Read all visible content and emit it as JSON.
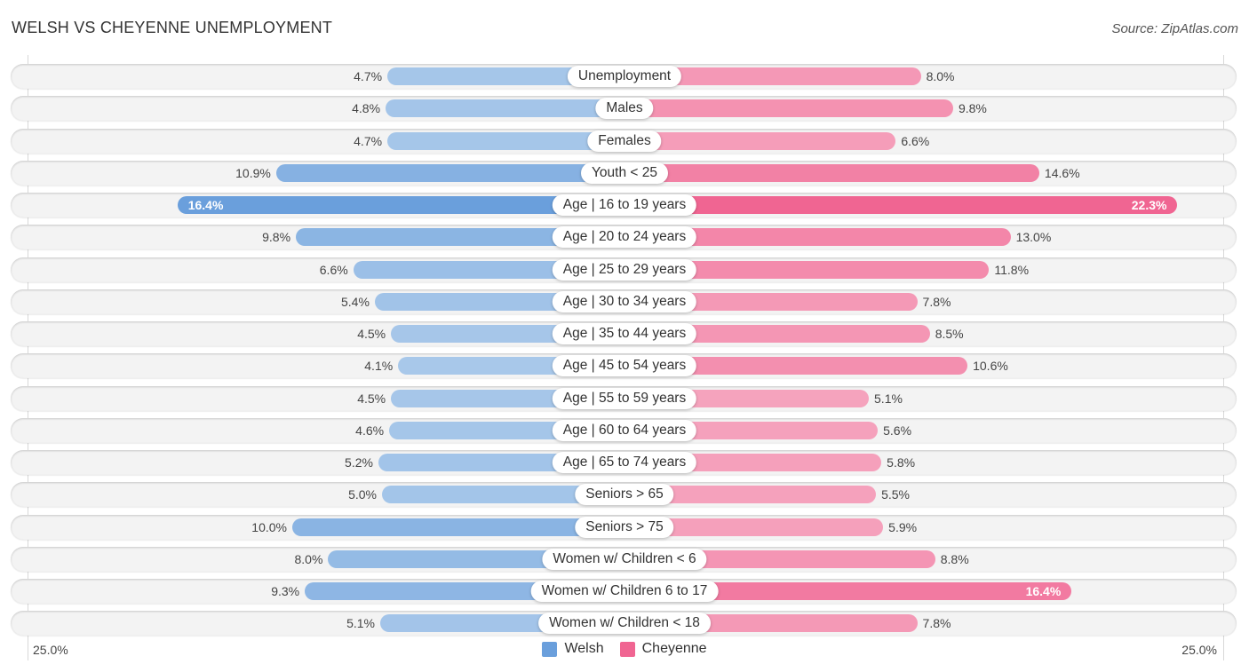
{
  "header": {
    "title": "WELSH VS CHEYENNE UNEMPLOYMENT",
    "source": "Source: ZipAtlas.com"
  },
  "legend": {
    "items": [
      {
        "label": "Welsh",
        "color": "#6a9fdc"
      },
      {
        "label": "Cheyenne",
        "color": "#f06592"
      }
    ]
  },
  "axis": {
    "left_label": "25.0%",
    "right_label": "25.0%"
  },
  "colors": {
    "welsh_light": "#a8c8ea",
    "welsh_dark": "#6a9fdc",
    "cheyenne_light": "#f5a3bd",
    "cheyenne_dark": "#f06592"
  },
  "chart_data": {
    "type": "bar",
    "orientation": "horizontal-diverging",
    "title": "WELSH VS CHEYENNE UNEMPLOYMENT",
    "xlabel": "",
    "ylabel": "",
    "xlim": [
      0,
      25.0
    ],
    "unit": "%",
    "legend_position": "bottom-center",
    "categories": [
      "Unemployment",
      "Males",
      "Females",
      "Youth < 25",
      "Age | 16 to 19 years",
      "Age | 20 to 24 years",
      "Age | 25 to 29 years",
      "Age | 30 to 34 years",
      "Age | 35 to 44 years",
      "Age | 45 to 54 years",
      "Age | 55 to 59 years",
      "Age | 60 to 64 years",
      "Age | 65 to 74 years",
      "Seniors > 65",
      "Seniors > 75",
      "Women w/ Children < 6",
      "Women w/ Children 6 to 17",
      "Women w/ Children < 18"
    ],
    "series": [
      {
        "name": "Welsh",
        "side": "left",
        "values": [
          4.7,
          4.8,
          4.7,
          10.9,
          16.4,
          9.8,
          6.6,
          5.4,
          4.5,
          4.1,
          4.5,
          4.6,
          5.2,
          5.0,
          10.0,
          8.0,
          9.3,
          5.1
        ],
        "labels": [
          "4.7%",
          "4.8%",
          "4.7%",
          "10.9%",
          "16.4%",
          "9.8%",
          "6.6%",
          "5.4%",
          "4.5%",
          "4.1%",
          "4.5%",
          "4.6%",
          "5.2%",
          "5.0%",
          "10.0%",
          "8.0%",
          "9.3%",
          "5.1%"
        ]
      },
      {
        "name": "Cheyenne",
        "side": "right",
        "values": [
          8.0,
          9.8,
          6.6,
          14.6,
          22.3,
          13.0,
          11.8,
          7.8,
          8.5,
          10.6,
          5.1,
          5.6,
          5.8,
          5.5,
          5.9,
          8.8,
          16.4,
          7.8
        ],
        "labels": [
          "8.0%",
          "9.8%",
          "6.6%",
          "14.6%",
          "22.3%",
          "13.0%",
          "11.8%",
          "7.8%",
          "8.5%",
          "10.6%",
          "5.1%",
          "5.6%",
          "5.8%",
          "5.5%",
          "5.9%",
          "8.8%",
          "16.4%",
          "7.8%"
        ]
      }
    ]
  }
}
